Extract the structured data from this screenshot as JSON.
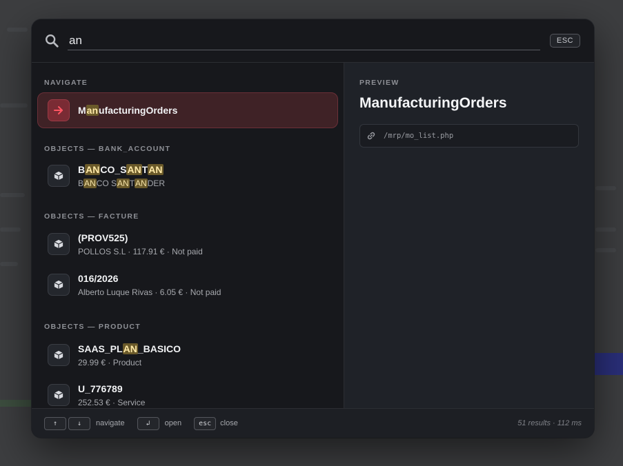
{
  "search": {
    "value": "an",
    "esc_label": "ESC"
  },
  "sections": {
    "navigate": "NAVIGATE",
    "bank_account": "OBJECTS — BANK_ACCOUNT",
    "facture": "OBJECTS — FACTURE",
    "product": "OBJECTS — PRODUCT"
  },
  "results": {
    "nav_item": {
      "title_parts": [
        "M",
        "an",
        "ufacturingOrders"
      ]
    },
    "bank": {
      "title_parts": [
        "B",
        "AN",
        "CO_S",
        "AN",
        "T",
        "AN"
      ],
      "sub_parts": [
        "B",
        "AN",
        "CO S",
        "AN",
        "T",
        "AN",
        "DER"
      ]
    },
    "facture_1": {
      "title": "(PROV525)",
      "sub": "POLLOS S.L · 117.91 € · Not paid"
    },
    "facture_2": {
      "title": "016/2026",
      "sub": "Alberto Luque Rivas · 6.05 € · Not paid"
    },
    "product_1": {
      "title_parts": [
        "SAAS_PL",
        "AN",
        "_BASICO"
      ],
      "sub": "29.99 € · Product"
    },
    "product_2": {
      "title": "U_776789",
      "sub": "252.53 € · Service"
    }
  },
  "preview": {
    "label": "PREVIEW",
    "title": "ManufacturingOrders",
    "link": "/mrp/mo_list.php"
  },
  "footer": {
    "key_up": "↑",
    "key_down": "↓",
    "navigate": "navigate",
    "key_enter": "↲",
    "open": "open",
    "key_esc": "esc",
    "close": "close",
    "status": "51 results · 112 ms"
  },
  "colors": {
    "accent": "#e0414f",
    "highlight_bg": "#6b5a2a"
  },
  "icons": {
    "search": "search-icon",
    "arrow": "arrow-right-icon",
    "object": "cube-icon",
    "link": "link-icon"
  }
}
